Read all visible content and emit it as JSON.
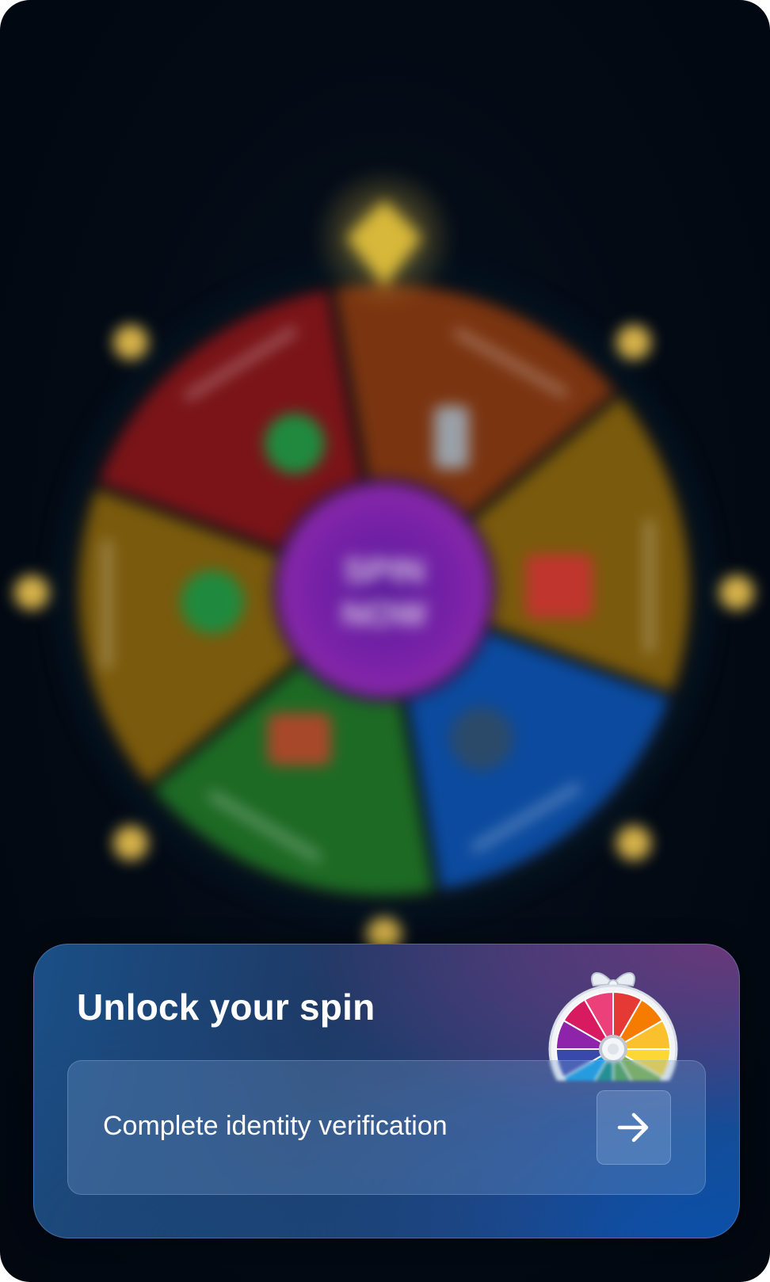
{
  "wheel": {
    "center_label_line1": "SPIN",
    "center_label_line2": "NOW",
    "segment_colors": [
      "#7a3410",
      "#7a5a0c",
      "#0b4a9e",
      "#1d6a24",
      "#7a5a0c",
      "#7a1418"
    ],
    "hub_color": "#7a1fa0",
    "pointer_color": "#d7b83a"
  },
  "card": {
    "title": "Unlock your spin",
    "action_label": "Complete identity verification",
    "arrow_icon": "arrow-right-icon",
    "mini_wheel_icon": "prize-wheel-icon"
  }
}
